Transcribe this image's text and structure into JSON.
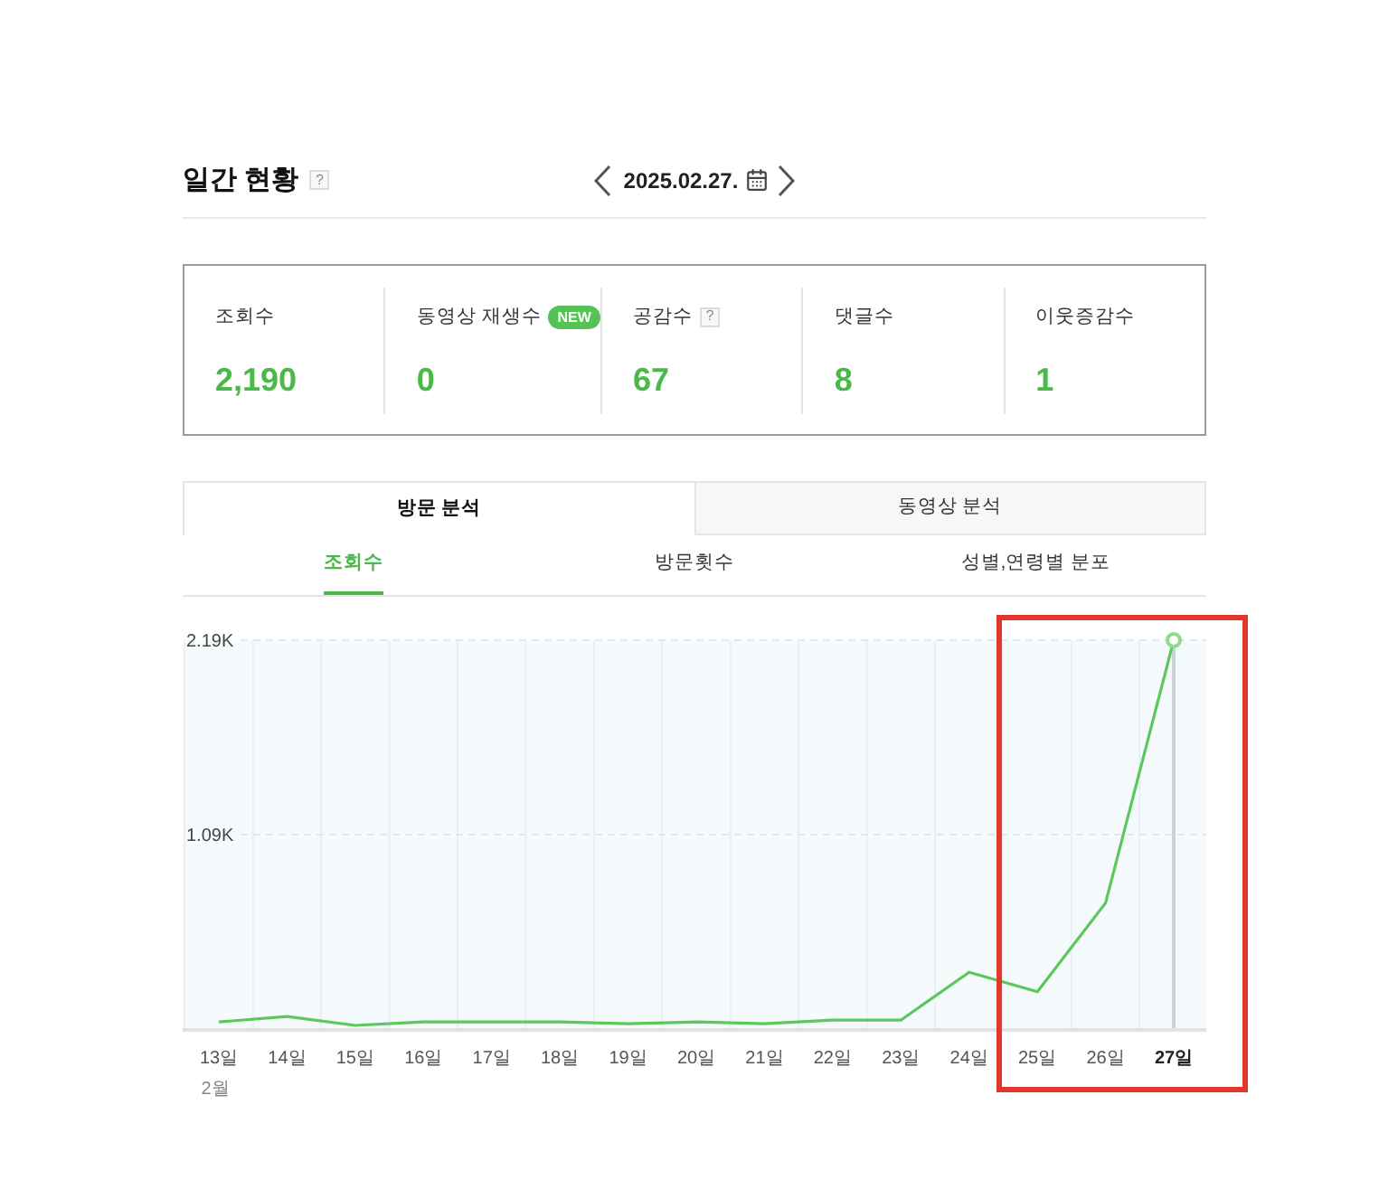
{
  "header": {
    "title": "일간 현황",
    "help": "?",
    "date": "2025.02.27."
  },
  "stats": [
    {
      "label": "조회수",
      "value": "2,190"
    },
    {
      "label": "동영상 재생수",
      "badge": "NEW",
      "value": "0"
    },
    {
      "label": "공감수",
      "help": "?",
      "value": "67"
    },
    {
      "label": "댓글수",
      "value": "8"
    },
    {
      "label": "이웃증감수",
      "value": "1"
    }
  ],
  "tabs": [
    {
      "label": "방문 분석",
      "selected": true
    },
    {
      "label": "동영상 분석",
      "selected": false
    }
  ],
  "subtabs": [
    {
      "label": "조회수",
      "selected": true
    },
    {
      "label": "방문횟수",
      "selected": false
    },
    {
      "label": "성별,연령별 분포",
      "selected": false
    }
  ],
  "chart": {
    "month_label": "2월",
    "points": [
      {
        "selected": false
      },
      {
        "selected": false
      },
      {
        "selected": false
      },
      {
        "selected": false
      },
      {
        "selected": false
      },
      {
        "selected": false
      },
      {
        "selected": false
      },
      {
        "selected": false
      },
      {
        "selected": false
      },
      {
        "selected": false
      },
      {
        "selected": false
      },
      {
        "selected": false
      },
      {
        "selected": false
      },
      {
        "selected": false
      },
      {
        "selected": true
      }
    ],
    "chart_data": {
      "type": "line",
      "categories": [
        "13일",
        "14일",
        "15일",
        "16일",
        "17일",
        "18일",
        "19일",
        "20일",
        "21일",
        "22일",
        "23일",
        "24일",
        "25일",
        "26일",
        "27일"
      ],
      "series": [
        {
          "color": "#5cc85c",
          "values": [
            40,
            70,
            20,
            40,
            40,
            40,
            30,
            40,
            30,
            50,
            50,
            320,
            210,
            710,
            2190
          ]
        }
      ],
      "ylim": [
        0,
        2190
      ],
      "yticks": [
        {
          "value": 1095,
          "label": "1.09K"
        },
        {
          "value": 2190,
          "label": "2.19K"
        }
      ],
      "ref_lines": [
        {
          "axis": "y",
          "value": 1095
        },
        {
          "axis": "y",
          "value": 2190
        },
        {
          "axis": "x",
          "value": "27일"
        }
      ]
    }
  },
  "annotations": [
    {
      "kind": "frame"
    }
  ]
}
